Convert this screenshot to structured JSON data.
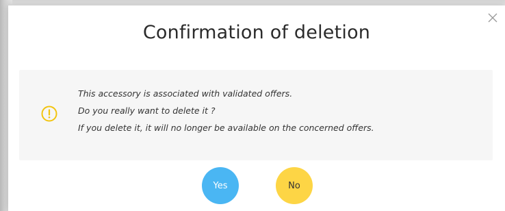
{
  "dialog": {
    "title": "Confirmation of deletion",
    "close_icon": "close-icon",
    "warning_icon": "warning-circle-icon",
    "message_lines": [
      "This accessory is associated with validated offers.",
      "Do you really want to delete it ?",
      "If you delete it, it will no longer be available on the concerned offers."
    ],
    "yes_label": "Yes",
    "no_label": "No"
  },
  "colors": {
    "yes_button": "#4ab6f3",
    "no_button": "#fdd545",
    "warning_icon": "#f2c40f",
    "message_background": "#f6f6f6"
  }
}
